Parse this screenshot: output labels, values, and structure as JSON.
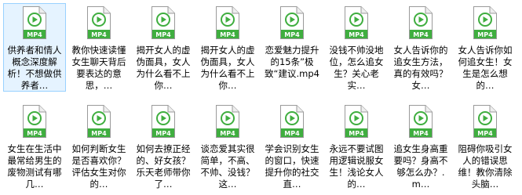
{
  "files": [
    {
      "name": "供养者和情人概念深度解析！不想做供养者…",
      "icon": "mp4-file-icon",
      "badge": "MP4",
      "selected": true
    },
    {
      "name": "教你快速读懂女生聊天背后要表达的意思，…",
      "icon": "mp4-file-icon",
      "badge": "MP4",
      "selected": false
    },
    {
      "name": "揭开女人的虚伪面具，女人为什么看不上你…",
      "icon": "mp4-file-icon",
      "badge": "MP4",
      "selected": false
    },
    {
      "name": "揭开女人的虚伪面具，女人为什么看不上你…",
      "icon": "mp4-file-icon",
      "badge": "MP4",
      "selected": false
    },
    {
      "name": "恋爱魅力提升的15条”极致“建议.mp4",
      "icon": "mp4-file-icon",
      "badge": "MP4",
      "selected": false
    },
    {
      "name": "没钱不帅没地位，怎么追女生？关心老实…",
      "icon": "mp4-file-icon",
      "badge": "MP4",
      "selected": false
    },
    {
      "name": "女人告诉你的追女生方法，真的有效吗？女…",
      "icon": "mp4-file-icon",
      "badge": "MP4",
      "selected": false
    },
    {
      "name": "女人告诉你如何追女生！女生是怎么想的…",
      "icon": "mp4-file-icon",
      "badge": "MP4",
      "selected": false
    },
    {
      "name": "女生在生活中最常给男生的废物测试有哪几…",
      "icon": "mp4-file-icon",
      "badge": "MP4",
      "selected": false
    },
    {
      "name": "如何判断女生是否喜欢你？评估女生对你的…",
      "icon": "mp4-file-icon",
      "badge": "MP4",
      "selected": false
    },
    {
      "name": "如何去撩正经的、好女孩？乐天老师带你了…",
      "icon": "mp4-file-icon",
      "badge": "MP4",
      "selected": false
    },
    {
      "name": "谈恋爱其实很简单，不高、不帅、没钱？这…",
      "icon": "mp4-file-icon",
      "badge": "MP4",
      "selected": false
    },
    {
      "name": "学会识别女生的窗口，快速提升你的社交直…",
      "icon": "mp4-file-icon",
      "badge": "MP4",
      "selected": false
    },
    {
      "name": "永远不要试图用逻辑说服女生！浅论女人的…",
      "icon": "mp4-file-icon",
      "badge": "MP4",
      "selected": false
    },
    {
      "name": "追女生身高重要吗？身高不够怎么办？.m…",
      "icon": "mp4-file-icon",
      "badge": "MP4",
      "selected": false
    },
    {
      "name": "阻碍你吸引女人的错误思维！教你清除头脑…",
      "icon": "mp4-file-icon",
      "badge": "MP4",
      "selected": false
    }
  ],
  "colors": {
    "accent": "#3fae3f",
    "selection_bg": "#e5f3ff",
    "selection_border": "#99d1ff"
  }
}
